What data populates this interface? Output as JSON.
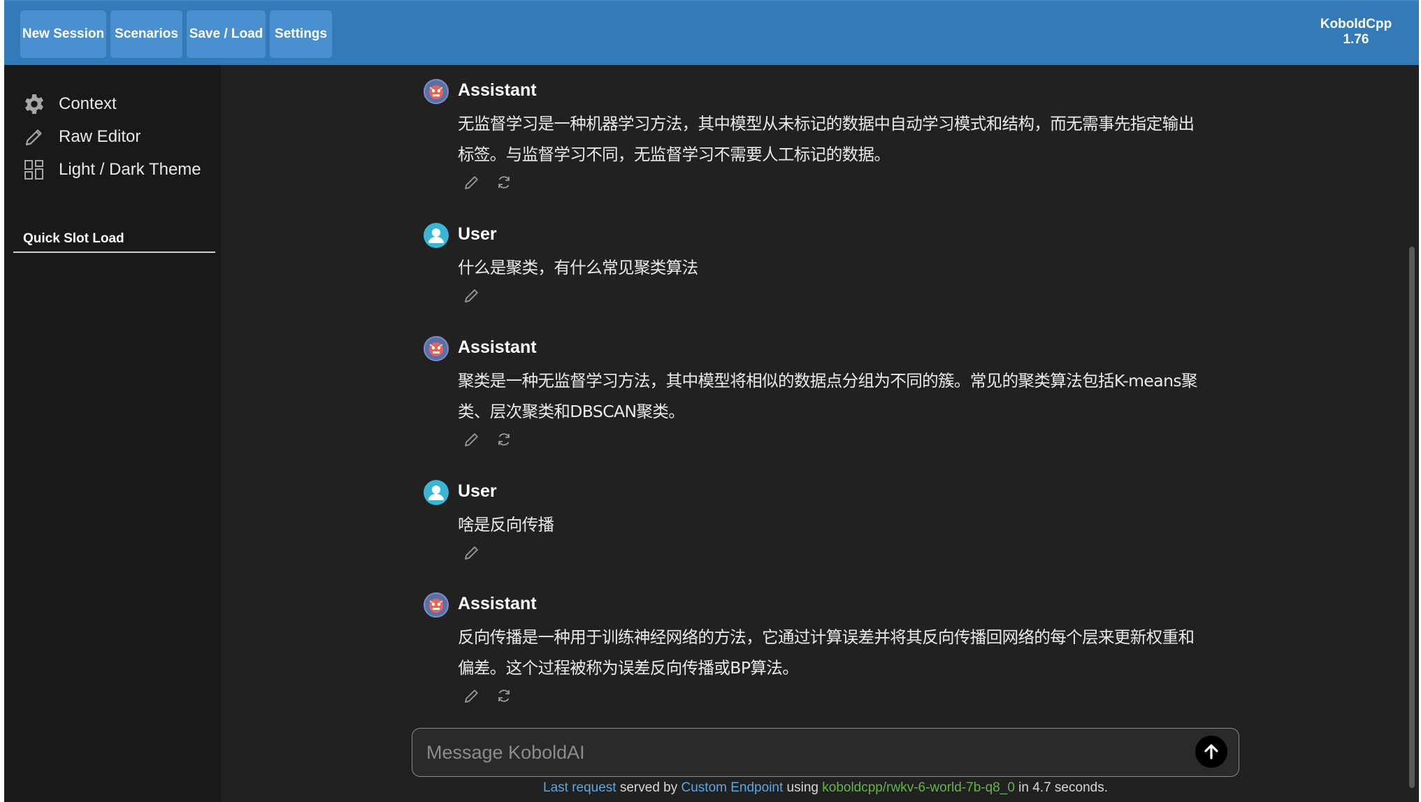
{
  "topbar": {
    "buttons": [
      "New Session",
      "Scenarios",
      "Save / Load",
      "Settings"
    ],
    "brand_name": "KoboldCpp",
    "brand_version": "1.76"
  },
  "sidebar": {
    "items": [
      {
        "label": "Context",
        "icon": "gear-icon"
      },
      {
        "label": "Raw Editor",
        "icon": "pencil-icon"
      },
      {
        "label": "Light / Dark Theme",
        "icon": "grid-icon"
      }
    ],
    "quick_slot_label": "Quick Slot Load"
  },
  "messages": [
    {
      "role": "Assistant",
      "text": "无监督学习是一种机器学习方法，其中模型从未标记的数据中自动学习模式和结构，而无需事先指定输出标签。与监督学习不同，无监督学习不需要人工标记的数据。"
    },
    {
      "role": "User",
      "text": "什么是聚类，有什么常见聚类算法"
    },
    {
      "role": "Assistant",
      "text": "聚类是一种无监督学习方法，其中模型将相似的数据点分组为不同的簇。常见的聚类算法包括K-means聚类、层次聚类和DBSCAN聚类。"
    },
    {
      "role": "User",
      "text": "啥是反向传播"
    },
    {
      "role": "Assistant",
      "text": "反向传播是一种用于训练神经网络的方法，它通过计算误差并将其反向传播回网络的每个层来更新权重和偏差。这个过程被称为误差反向传播或BP算法。"
    }
  ],
  "composer": {
    "placeholder": "Message KoboldAI"
  },
  "footer": {
    "last_request": "Last request",
    "served_by": "served by",
    "endpoint": "Custom Endpoint",
    "using": "using",
    "model": "koboldcpp/rwkv-6-world-7b-q8_0",
    "duration": "in 4.7 seconds."
  },
  "colors": {
    "topbar": "#337ab7",
    "button": "#4a8fd0",
    "chat_bg": "#212121",
    "sidebar_bg": "#191919",
    "link": "#5aa6e6",
    "model": "#67b34a"
  }
}
